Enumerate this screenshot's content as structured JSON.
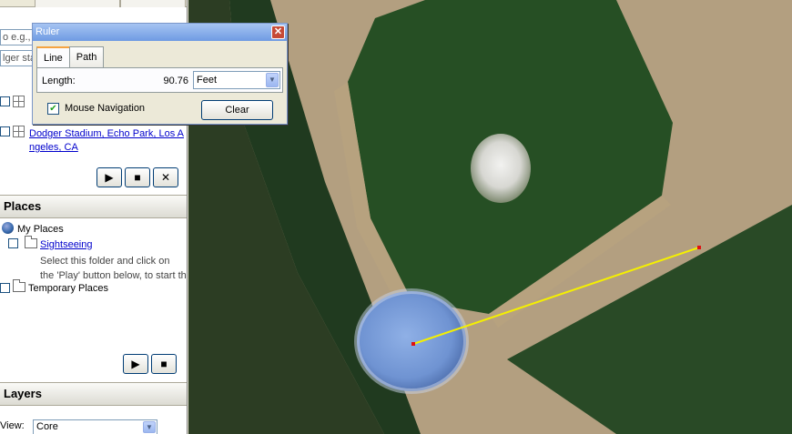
{
  "left_panel": {
    "search": {
      "field_1_text": "o e.g.,",
      "field_2_text": "lger sta"
    },
    "results": [
      {
        "label": "Dodger Stadium, Echo Park, Los Angeles, CA",
        "line1": "Dodger Stadium, Echo Park, Los A",
        "line2": "ngeles, CA"
      },
      {
        "label": ""
      }
    ],
    "search_buttons": {
      "play": "▶",
      "stop": "■",
      "close": "✕"
    },
    "places": {
      "header": "Places",
      "my_places": "My Places",
      "sightseeing": "Sightseeing",
      "sightseeing_desc_1": "Select this folder and click on",
      "sightseeing_desc_2": "the 'Play' button below, to start th",
      "temporary_places": "Temporary Places",
      "buttons": {
        "play": "▶",
        "stop": "■"
      }
    },
    "layers": {
      "header": "Layers",
      "view_label": "View:",
      "view_value": "Core"
    }
  },
  "ruler_dialog": {
    "title": "Ruler",
    "close_glyph": "✕",
    "tabs": [
      "Line",
      "Path"
    ],
    "active_tab": "Line",
    "length_label": "Length:",
    "length_value": "90.76",
    "unit_value": "Feet",
    "mouse_navigation_label": "Mouse Navigation",
    "mouse_navigation_checked": true,
    "check_glyph": "✔",
    "clear_label": "Clear"
  },
  "map": {
    "ruler_line_color": "#f5f000",
    "endpoint_color": "#e01010"
  },
  "colors": {
    "titlebar": "#7aa2e8",
    "link": "#0000cc"
  }
}
